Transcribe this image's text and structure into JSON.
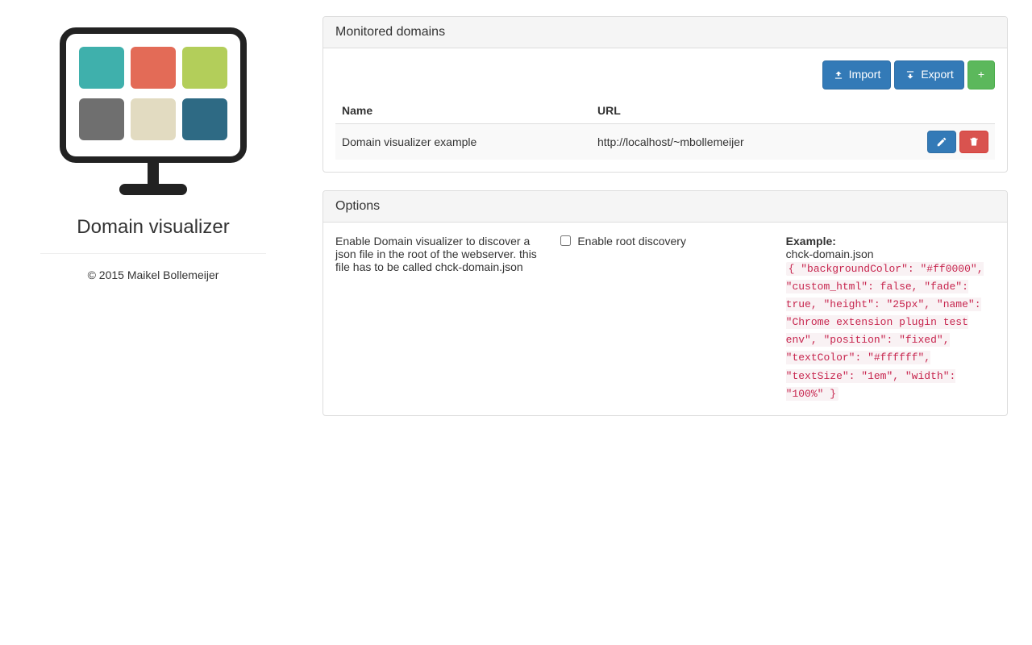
{
  "sidebar": {
    "app_title": "Domain visualizer",
    "copyright": "© 2015 Maikel Bollemeijer",
    "logo_tiles": [
      "#3fb0ac",
      "#e36b57",
      "#b3ce5a",
      "#6f6f6f",
      "#e2dbc1",
      "#2e6a84"
    ]
  },
  "domains_panel": {
    "title": "Monitored domains",
    "toolbar": {
      "import_label": "Import",
      "export_label": "Export",
      "add_label": "+"
    },
    "columns": {
      "name": "Name",
      "url": "URL"
    },
    "rows": [
      {
        "name": "Domain visualizer example",
        "url": "http://localhost/~mbollemeijer"
      }
    ]
  },
  "options_panel": {
    "title": "Options",
    "description": "Enable Domain visualizer to discover a json file in the root of the webserver. this file has to be called chck-domain.json",
    "checkbox_label": "Enable root discovery",
    "example_heading": "Example:",
    "example_filename": "chck-domain.json",
    "example_json": "{ \"backgroundColor\": \"#ff0000\", \"custom_html\": false, \"fade\": true, \"height\": \"25px\", \"name\": \"Chrome extension plugin test env\", \"position\": \"fixed\", \"textColor\": \"#ffffff\", \"textSize\": \"1em\", \"width\": \"100%\" }"
  }
}
